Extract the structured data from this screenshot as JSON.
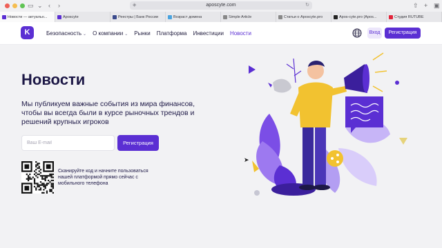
{
  "browser": {
    "url": "aposcyte.com",
    "tabs": [
      {
        "title": "Новости — актуальн...",
        "color": "#5b2fd3",
        "active": true
      },
      {
        "title": "Aposcyte",
        "color": "#5b2fd3",
        "active": false
      },
      {
        "title": "Реестры | Банк России",
        "color": "#3a4a8c",
        "active": false
      },
      {
        "title": "Возраст домена",
        "color": "#4aa3df",
        "active": false
      },
      {
        "title": "Simple Article",
        "color": "#888888",
        "active": false
      },
      {
        "title": "Статьи о Aposcyte.pro",
        "color": "#888888",
        "active": false
      },
      {
        "title": "Apos-cyte.pro (Apos...",
        "color": "#222222",
        "active": false
      },
      {
        "title": "Студия RUTUBE",
        "color": "#e2233a",
        "active": false
      }
    ]
  },
  "header": {
    "logo_letter": "K",
    "nav": [
      {
        "label": "Безопасность",
        "dropdown": true,
        "active": false
      },
      {
        "label": "О компании",
        "dropdown": true,
        "active": false
      },
      {
        "label": "Рынки",
        "dropdown": false,
        "active": false
      },
      {
        "label": "Платформа",
        "dropdown": false,
        "active": false
      },
      {
        "label": "Инвестиции",
        "dropdown": false,
        "active": false
      },
      {
        "label": "Новости",
        "dropdown": false,
        "active": true
      }
    ],
    "login_label": "Вход",
    "register_label": "Регистрация"
  },
  "hero": {
    "title": "Новости",
    "subtitle": "Мы публикуем важные события из мира финансов, чтобы вы всегда были в курсе рыночных трендов и решений крупных игроков",
    "email_placeholder": "Ваш E-mail",
    "register_label": "Регистрация",
    "qr_text": "Сканируйте код и начните пользоваться нашей платформой прямо сейчас с мобильного телефона"
  },
  "colors": {
    "brand": "#5b2fd3",
    "text_dark": "#1d1846",
    "accent_yellow": "#f2c230"
  }
}
